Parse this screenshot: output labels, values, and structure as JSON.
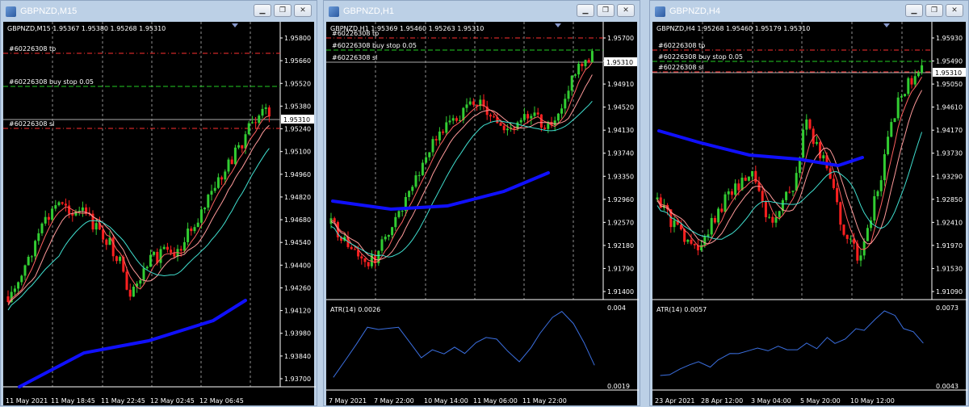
{
  "windows": [
    {
      "id": "m15",
      "title": "GBPNZD,M15",
      "info": "GBPNZD,M15  1.95367 1.95380 1.95268 1.95310",
      "tp_label": "#60226308 tp",
      "buystop_label": "#60226308 buy stop 0.05",
      "sl_label": "#60226308 sl",
      "price_tag": "1.95310",
      "price_axis": [
        "1.95800",
        "1.95660",
        "1.95520",
        "1.95380",
        "1.95240",
        "1.95100",
        "1.94960",
        "1.94820",
        "1.94680",
        "1.94540",
        "1.94400",
        "1.94260",
        "1.94120",
        "1.93980",
        "1.93840",
        "1.93700"
      ],
      "time_axis": [
        "11 May 2021",
        "11 May 18:45",
        "11 May 22:45",
        "12 May 02:45",
        "12 May 06:45"
      ],
      "has_atr": false
    },
    {
      "id": "h1",
      "title": "GBPNZD,H1",
      "info": "GBPNZD,H1  1.95369 1.95460 1.95263 1.95310",
      "tp_label": "#60226308 tp",
      "buystop_label": "#60226308 buy stop 0.05",
      "sl_label": "#60226308 sl",
      "price_tag": "1.95310",
      "price_axis": [
        "1.95700",
        "1.95310",
        "1.94910",
        "1.94520",
        "1.94130",
        "1.93740",
        "1.93350",
        "1.92960",
        "1.92570",
        "1.92180",
        "1.91790",
        "1.91400"
      ],
      "time_axis": [
        "7 May 2021",
        "7 May 22:00",
        "10 May 14:00",
        "11 May 06:00",
        "11 May 22:00"
      ],
      "has_atr": true,
      "atr_label": "ATR(14) 0.0026",
      "atr_max": "0.004",
      "atr_min": "0.0019"
    },
    {
      "id": "h4",
      "title": "GBPNZD,H4",
      "info": "GBPNZD,H4  1.95268 1.95460 1.95179 1.95310",
      "tp_label": "#60226308 tp",
      "buystop_label": "#60226308 buy stop 0.05",
      "sl_label": "#60226308 sl",
      "price_tag": "1.95310",
      "price_axis": [
        "1.95930",
        "1.95490",
        "1.95050",
        "1.94610",
        "1.94170",
        "1.93730",
        "1.93290",
        "1.92850",
        "1.92410",
        "1.91970",
        "1.91530",
        "1.91090"
      ],
      "time_axis": [
        "23 Apr 2021",
        "28 Apr 12:00",
        "3 May 04:00",
        "5 May 20:00",
        "10 May 12:00"
      ],
      "has_atr": true,
      "atr_label": "ATR(14) 0.0057",
      "atr_max": "0.0073",
      "atr_min": "0.0043"
    }
  ],
  "colors": {
    "bull": "#32cd32",
    "bear": "#ff2020",
    "ma200": "#1010ff",
    "ma_fast": "#ff6060",
    "ma_mid": "#ff9a9a",
    "ma_slow": "#40e0d0",
    "atr": "#3b6fe0",
    "tp_line": "#ff3030",
    "buystop_line": "#22cc22",
    "sl_line": "#ff3030"
  },
  "icons": {
    "minimize": "minimize-icon",
    "restore": "restore-icon",
    "close": "close-icon"
  }
}
